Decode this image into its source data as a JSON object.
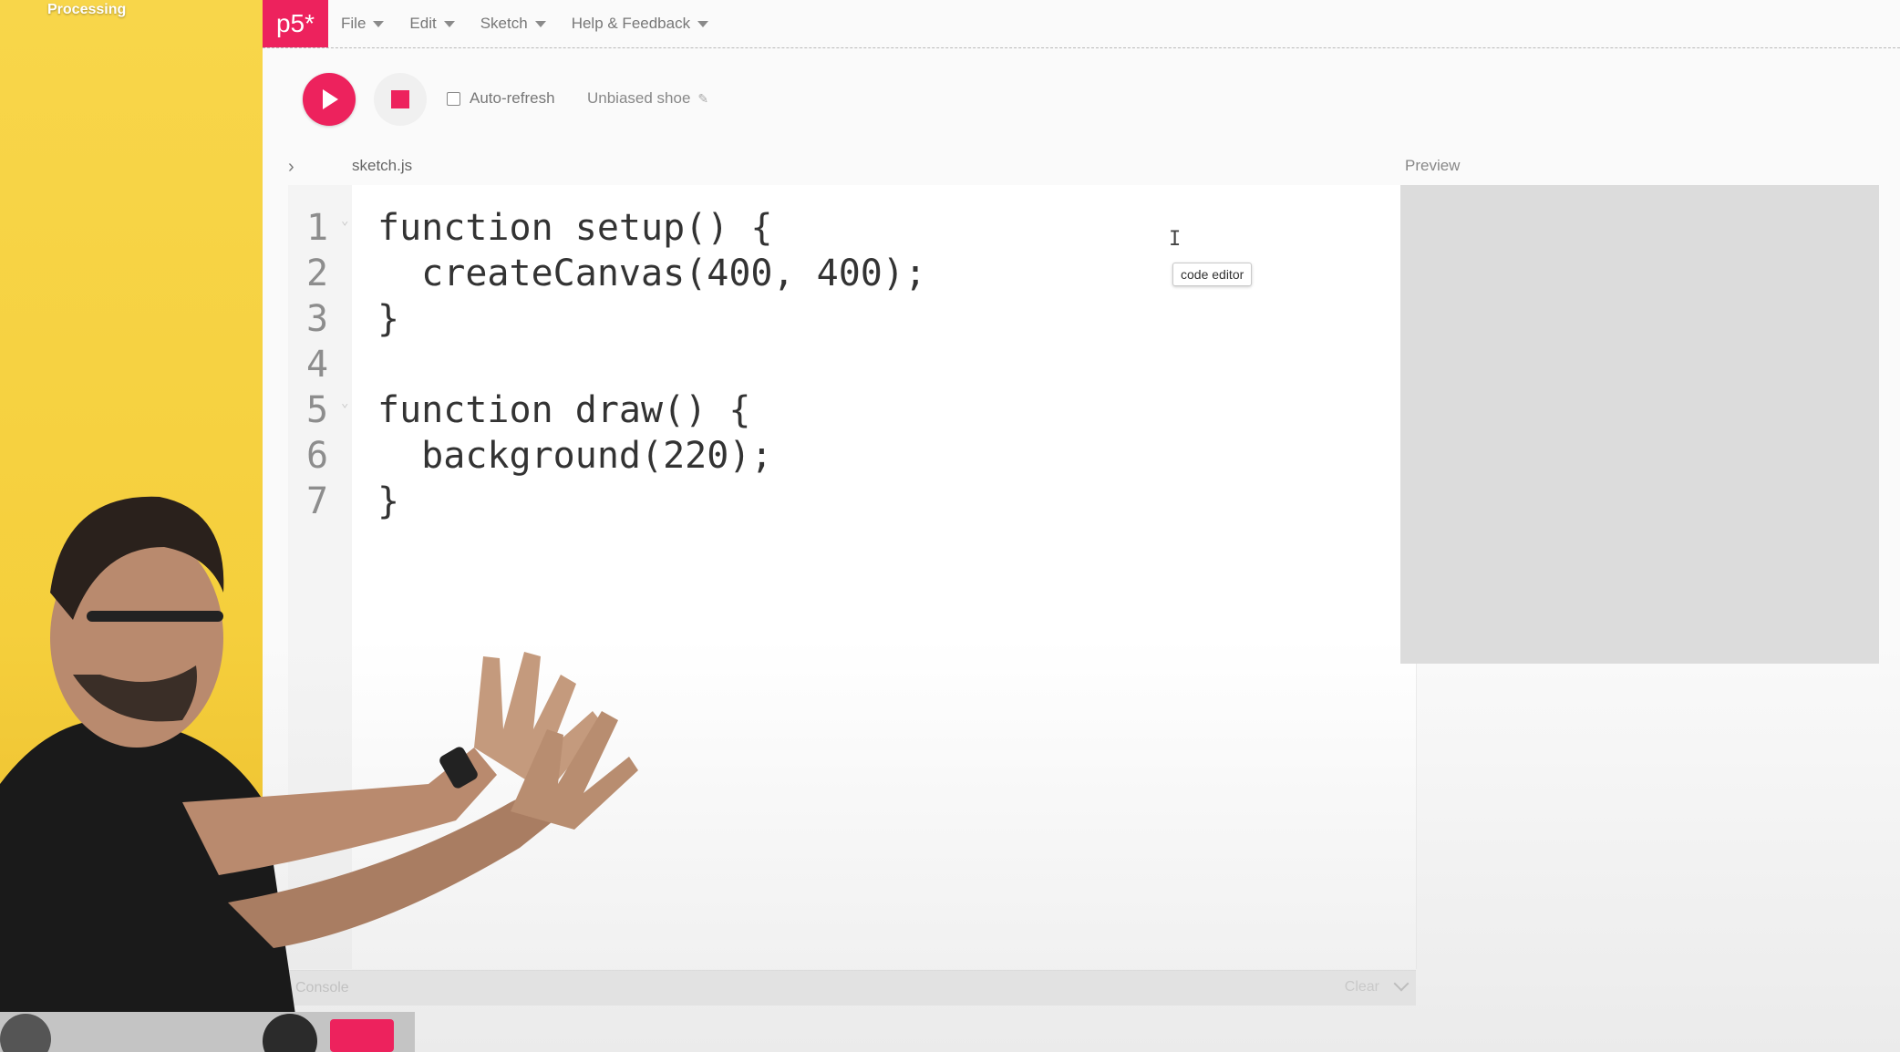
{
  "overlay": {
    "channel_label": "Processing"
  },
  "app": {
    "logo": "p5*",
    "menu": [
      {
        "label": "File"
      },
      {
        "label": "Edit"
      },
      {
        "label": "Sketch"
      },
      {
        "label": "Help & Feedback"
      }
    ],
    "toolbar": {
      "auto_refresh_label": "Auto-refresh",
      "auto_refresh_checked": false,
      "sketch_name": "Unbiased shoe"
    },
    "tabs": {
      "file_tab": "sketch.js",
      "preview_label": "Preview"
    },
    "tooltip": "code editor",
    "code_lines": [
      {
        "n": "1",
        "text": "function setup() {"
      },
      {
        "n": "2",
        "text": "  createCanvas(400, 400);"
      },
      {
        "n": "3",
        "text": "}"
      },
      {
        "n": "4",
        "text": ""
      },
      {
        "n": "5",
        "text": "function draw() {"
      },
      {
        "n": "6",
        "text": "  background(220);"
      },
      {
        "n": "7",
        "text": "}"
      }
    ],
    "console": {
      "label": "Console",
      "clear_label": "Clear"
    },
    "colors": {
      "accent": "#ed225d",
      "preview_bg": "#dcdcdc",
      "side_panel": "#f8d64a"
    }
  }
}
